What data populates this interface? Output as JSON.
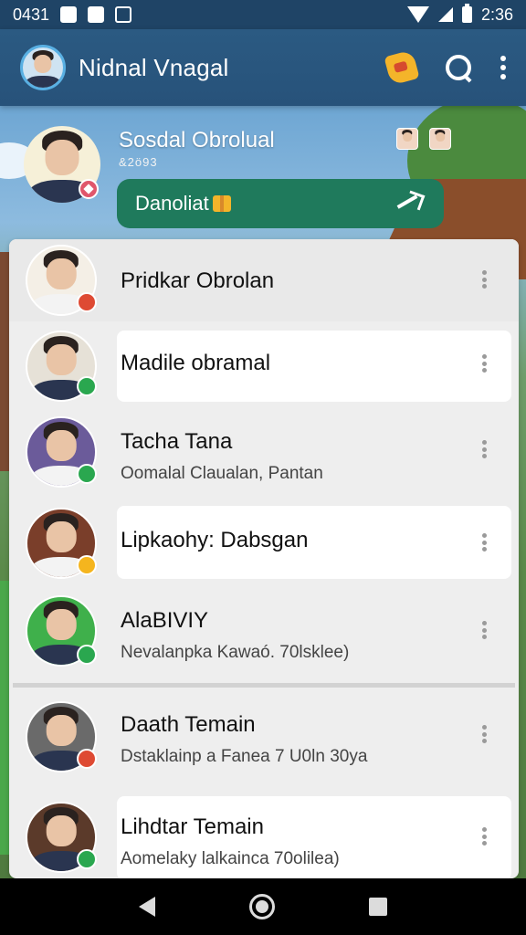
{
  "status_bar": {
    "time_left": "0431",
    "time_right": "2:36"
  },
  "app_bar": {
    "title": "Nidnal Vnagal"
  },
  "profile": {
    "name": "Sosdal Obrolual",
    "sub": "&2ö93"
  },
  "action_button": {
    "label": "Danoliat"
  },
  "chats": [
    {
      "title": "Pridkar Obrolan",
      "sub": "",
      "status": "red"
    },
    {
      "title": "Madile obramal",
      "sub": "",
      "status": "green"
    },
    {
      "title": "Tacha Tana",
      "sub": "Oomalal Claualan, Pantan",
      "status": "green"
    },
    {
      "title": "Lipkaohy: Dabsgan",
      "sub": "",
      "status": "yellow"
    },
    {
      "title": "AlaBIVIY",
      "sub": "Nevalanpka Kawaó. 70lsklee)",
      "status": "green"
    },
    {
      "title": "Daath Temain",
      "sub": "Dstaklainp a Fanea 7 U0ln 30ya",
      "status": "red"
    },
    {
      "title": "Lihdtar Temain",
      "sub": "Aomelaky lalkainca 70olilea)",
      "status": "green"
    }
  ],
  "colors": {
    "app_bar": "#27527a",
    "action_pill": "#1f7a5c",
    "status_red": "#de4a33",
    "status_green": "#2aa74f",
    "status_yellow": "#f5b51e"
  },
  "icons": [
    "wifi-icon",
    "signal-icon",
    "battery-icon",
    "emoji-sticker-icon",
    "search-icon",
    "more-vert-icon",
    "gift-icon",
    "share-icon",
    "back-icon",
    "home-icon",
    "recents-icon"
  ]
}
